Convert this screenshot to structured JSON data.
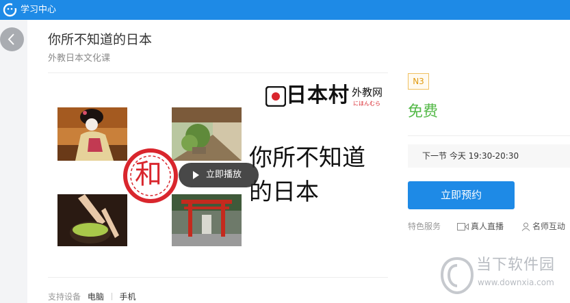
{
  "header": {
    "app_title": "学习中心"
  },
  "course": {
    "title": "你所不知道的日本",
    "subtitle": "外教日本文化课",
    "cover": {
      "brand": "日本村",
      "brand_suffix": "外教网",
      "brand_kana": "にほんむら",
      "headline_line1": "你所不知道",
      "headline_line2": "的日本",
      "seal_char": "和",
      "play_label": "立即播放"
    },
    "support_label": "支持设备",
    "devices": [
      "电脑",
      "手机"
    ]
  },
  "sidebar_panel": {
    "level": "N3",
    "price": "免费",
    "next_session": "下一节 今天 19:30-20:30",
    "book_label": "立即预约",
    "features_label": "特色服务",
    "features": [
      {
        "icon": "video-camera-icon",
        "label": "真人直播"
      },
      {
        "icon": "person-icon",
        "label": "名师互动"
      }
    ]
  },
  "watermark": {
    "name": "当下软件园",
    "url": "www.downxia.com"
  },
  "colors": {
    "accent": "#1e8ae6",
    "price": "#54b948",
    "level_badge": "#e09a10",
    "seal": "#d9262d"
  }
}
